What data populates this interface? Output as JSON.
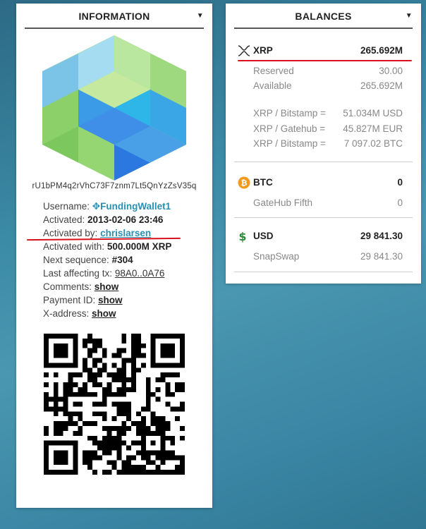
{
  "information": {
    "title": "INFORMATION",
    "address": "rU1bPM4q2rVhC73F7znm7Lt5QnYzZsV35q",
    "rows": {
      "username_label": "Username:",
      "username_value": "FundingWallet1",
      "activated_label": "Activated:",
      "activated_value": "2013-02-06 23:46",
      "activated_by_label": "Activated by:",
      "activated_by_value": "chrislarsen",
      "activated_with_label": "Activated with:",
      "activated_with_value": "500.000M XRP",
      "next_seq_label": "Next sequence:",
      "next_seq_value": "#304",
      "last_tx_label": "Last affecting tx:",
      "last_tx_value": "98A0..0A76",
      "comments_label": "Comments:",
      "comments_value": "show",
      "payment_id_label": "Payment ID:",
      "payment_id_value": "show",
      "xaddress_label": "X-address:",
      "xaddress_value": "show"
    },
    "icons": {
      "username": "ripple-icon",
      "toggle": "caret-down-icon"
    }
  },
  "balances": {
    "title": "BALANCES",
    "xrp": {
      "currency": "XRP",
      "total": "265.692M",
      "reserved_label": "Reserved",
      "reserved_value": "30.00",
      "available_label": "Available",
      "available_value": "265.692M",
      "rates": [
        {
          "label": "XRP / Bitstamp =",
          "value": "51.034M USD"
        },
        {
          "label": "XRP / Gatehub =",
          "value": "45.827M EUR"
        },
        {
          "label": "XRP / Bitstamp =",
          "value": "7 097.02 BTC"
        }
      ]
    },
    "btc": {
      "currency": "BTC",
      "total": "0",
      "issuer": "GateHub Fifth",
      "issuer_value": "0"
    },
    "usd": {
      "currency": "USD",
      "total": "29 841.30",
      "issuer": "SnapSwap",
      "issuer_value": "29 841.30"
    }
  },
  "colors": {
    "link_teal": "#2a8fb0",
    "highlight_red": "#d8121a",
    "btc_orange": "#f39a1d",
    "usd_green": "#2e8b3a"
  }
}
